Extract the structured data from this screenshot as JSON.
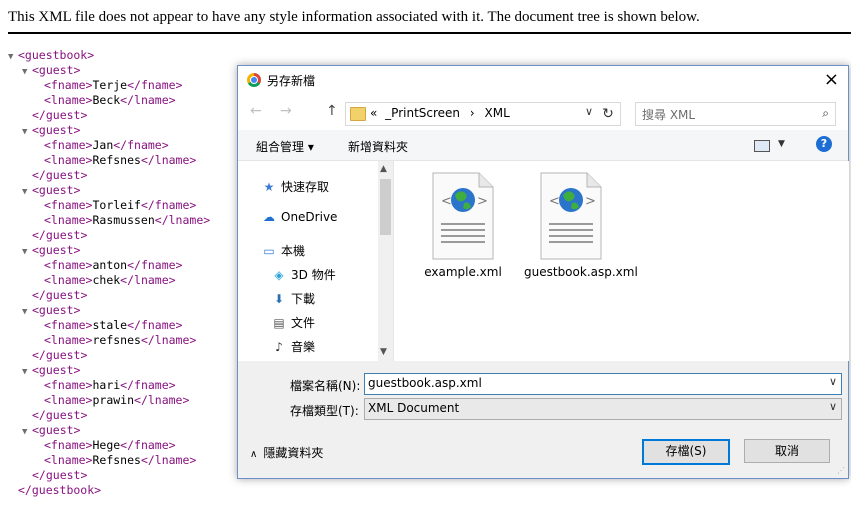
{
  "notice": "This XML file does not appear to have any style information associated with it. The document tree is shown below.",
  "xml": {
    "root_open": "<guestbook>",
    "root_close": "</guestbook>",
    "guests": [
      {
        "fname": "Terje",
        "lname": "Beck"
      },
      {
        "fname": "Jan",
        "lname": "Refsnes"
      },
      {
        "fname": "Torleif",
        "lname": "Rasmussen"
      },
      {
        "fname": "anton",
        "lname": "chek"
      },
      {
        "fname": "stale",
        "lname": "refsnes"
      },
      {
        "fname": "hari",
        "lname": "prawin"
      },
      {
        "fname": "Hege",
        "lname": "Refsnes"
      }
    ],
    "guest_open": "<guest>",
    "guest_close": "</guest>",
    "fname_open": "<fname>",
    "fname_close": "</fname>",
    "lname_open": "<lname>",
    "lname_close": "</lname>"
  },
  "dialog": {
    "title": "另存新檔",
    "close_icon": "×",
    "nav": {
      "back": "←",
      "forward": "→",
      "up": "↑",
      "refresh": "↻"
    },
    "address": {
      "prefix": "«",
      "path1": "_PrintScreen",
      "sep": "›",
      "path2": "XML",
      "dropdown": "∨"
    },
    "search_placeholder": "搜尋 XML",
    "search_icon": "⌕",
    "toolbar": {
      "organize": "組合管理 ▾",
      "new_folder": "新增資料夾",
      "help": "?"
    },
    "nav_pane": [
      {
        "label": "快速存取",
        "icon": "★"
      },
      {
        "label": "OneDrive",
        "icon": "☁"
      },
      {
        "label": "本機",
        "icon": "▭"
      },
      {
        "label": "3D 物件",
        "icon": "◈"
      },
      {
        "label": "下載",
        "icon": "⬇"
      },
      {
        "label": "文件",
        "icon": "▤"
      },
      {
        "label": "音樂",
        "icon": "♪"
      }
    ],
    "files": [
      {
        "name": "example.xml"
      },
      {
        "name": "guestbook.asp.xml"
      }
    ],
    "filename_label": "檔案名稱(N):",
    "filename_value": "guestbook.asp.xml",
    "filetype_label": "存檔類型(T):",
    "filetype_value": "XML Document",
    "hide_folders": "隱藏資料夾",
    "save_button": "存檔(S)",
    "cancel_button": "取消",
    "colors": {
      "accent": "#0078d7",
      "tag": "#881280"
    }
  }
}
